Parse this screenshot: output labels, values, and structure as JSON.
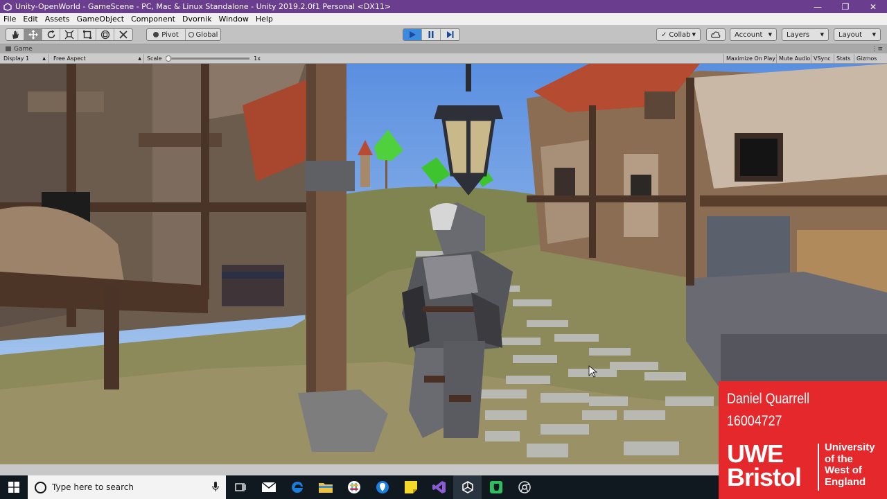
{
  "window": {
    "title": "Unity-OpenWorld - GameScene - PC, Mac & Linux Standalone - Unity 2019.2.0f1 Personal <DX11>",
    "controls": [
      "minimize-icon",
      "restore-icon",
      "close-icon"
    ]
  },
  "menu": {
    "items": [
      "File",
      "Edit",
      "Assets",
      "GameObject",
      "Component",
      "Dvornik",
      "Window",
      "Help"
    ]
  },
  "toolbar": {
    "tools": [
      "hand-icon",
      "move-icon",
      "rotate-icon",
      "scale-icon",
      "rect-icon",
      "transform-icon",
      "custom-tool-icon"
    ],
    "pivot_label": "Pivot",
    "global_label": "Global",
    "play_state": "playing",
    "collab_label": "Collab",
    "account_label": "Account",
    "layers_label": "Layers",
    "layout_label": "Layout"
  },
  "game_view": {
    "tab_label": "Game",
    "display": "Display 1",
    "aspect": "Free Aspect",
    "scale_label": "Scale",
    "scale_value": "1x",
    "scale_fraction": 0.0,
    "toggles": [
      "Maximize On Play",
      "Mute Audio",
      "VSync",
      "Stats",
      "Gizmos"
    ]
  },
  "taskbar": {
    "search_placeholder": "Type here to search",
    "apps": [
      "task-view-icon",
      "mail-icon",
      "edge-icon",
      "file-explorer-icon",
      "slack-icon",
      "maps-icon",
      "sticky-notes-icon",
      "visual-studio-icon",
      "unity-icon",
      "evernote-icon",
      "chrome-like-icon"
    ]
  },
  "overlay": {
    "name": "Daniel Quarrell",
    "student_id": "16004727",
    "logo_line1": "UWE",
    "logo_line2": "Bristol",
    "university_lines": [
      "University",
      "of the",
      "West of",
      "England"
    ]
  },
  "colors": {
    "title_bar": "#6a3d8f",
    "play_active": "#3b8be0",
    "overlay_red": "#e5282b",
    "taskbar": "#101820"
  }
}
